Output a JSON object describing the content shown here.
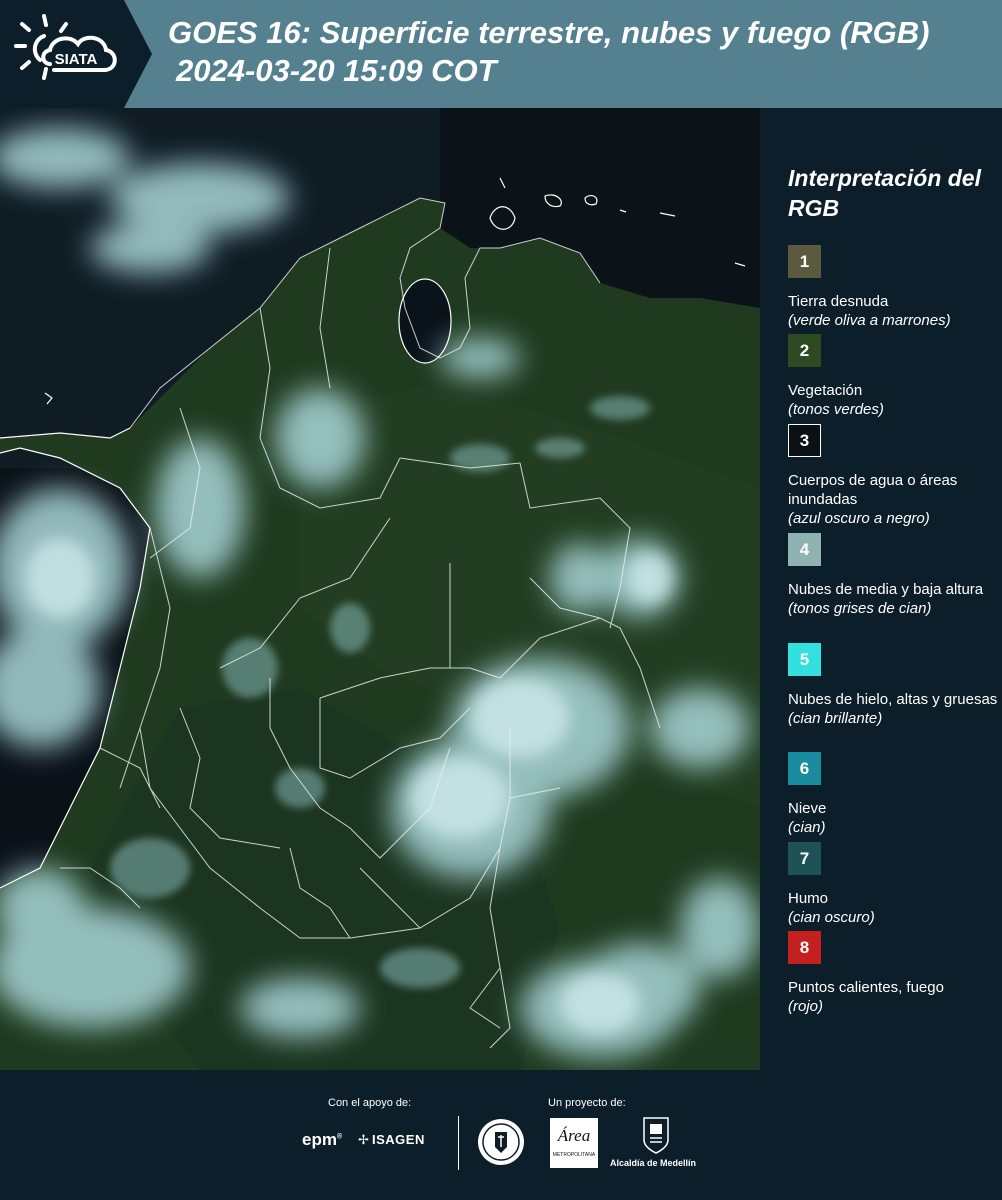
{
  "header": {
    "logo_text": "SIATA",
    "title_line1": "GOES 16: Superficie terrestre, nubes y fuego (RGB)",
    "title_line2": "2024-03-20 15:09 COT"
  },
  "legend": {
    "title": "Interpretación del RGB",
    "items": [
      {
        "num": "1",
        "label": "Tierra desnuda",
        "desc": "(verde oliva a marrones)",
        "color": "#5b5a3f"
      },
      {
        "num": "2",
        "label": "Vegetación",
        "desc": "(tonos verdes)",
        "color": "#2e4a22"
      },
      {
        "num": "3",
        "label": "Cuerpos de agua o áreas inundadas",
        "desc": "(azul oscuro a negro)",
        "color": "#0a1014"
      },
      {
        "num": "4",
        "label": "Nubes de media y baja altura",
        "desc": "(tonos grises de cian)",
        "color": "#8fb3b3"
      },
      {
        "num": "5",
        "label": "Nubes de hielo, altas y gruesas",
        "desc": "(cian brillante)",
        "color": "#33e0e0"
      },
      {
        "num": "6",
        "label": "Nieve",
        "desc": "(cian)",
        "color": "#1a8ca0"
      },
      {
        "num": "7",
        "label": "Humo",
        "desc": "(cian oscuro)",
        "color": "#1d5256"
      },
      {
        "num": "8",
        "label": "Puntos calientes, fuego",
        "desc": "(rojo)",
        "color": "#c42020"
      }
    ]
  },
  "footer": {
    "support_label": "Con el apoyo de:",
    "project_label": "Un proyecto de:",
    "epm": "epm",
    "isagen": "ISAGEN",
    "area": "Área",
    "area_sub": "METROPOLITANA",
    "alcaldia": "Alcaldía de Medellín"
  }
}
